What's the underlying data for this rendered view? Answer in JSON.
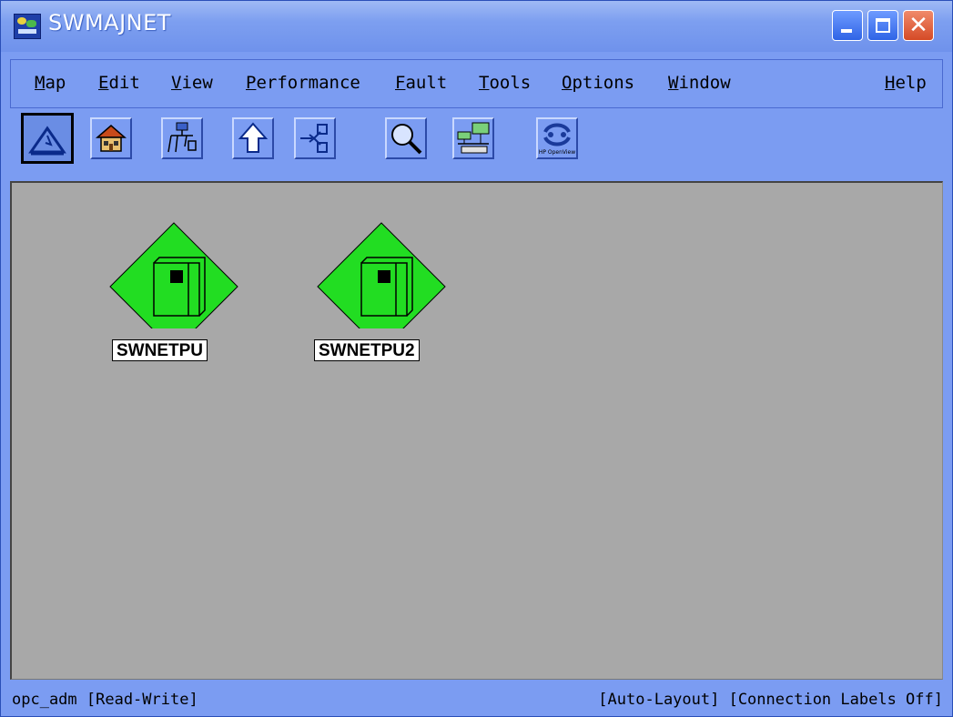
{
  "window": {
    "title": "SWMAJNET"
  },
  "menu": [
    {
      "mnemonic": "M",
      "rest": "ap"
    },
    {
      "mnemonic": "E",
      "rest": "dit"
    },
    {
      "mnemonic": "V",
      "rest": "iew"
    },
    {
      "mnemonic": "P",
      "rest": "erformance"
    },
    {
      "mnemonic": "F",
      "rest": "ault"
    },
    {
      "mnemonic": "T",
      "rest": "ools"
    },
    {
      "mnemonic": "O",
      "rest": "ptions"
    },
    {
      "mnemonic": "W",
      "rest": "indow"
    },
    {
      "mnemonic": "H",
      "rest": "elp"
    }
  ],
  "toolbar": {
    "buttons": [
      "close-submap-icon",
      "home-map-icon",
      "root-map-icon",
      "parent-map-icon",
      "quick-navigator-icon",
      "find-icon",
      "network-node-manager-icon",
      "hp-openview-icon"
    ],
    "openview_logo_text": "HP OpenView"
  },
  "map": {
    "nodes": [
      {
        "label": "SWNETPU",
        "color": "#22dd22"
      },
      {
        "label": "SWNETPU2",
        "color": "#22dd22"
      }
    ]
  },
  "status": {
    "left": "opc_adm [Read-Write]",
    "right": "[Auto-Layout] [Connection Labels Off]"
  }
}
